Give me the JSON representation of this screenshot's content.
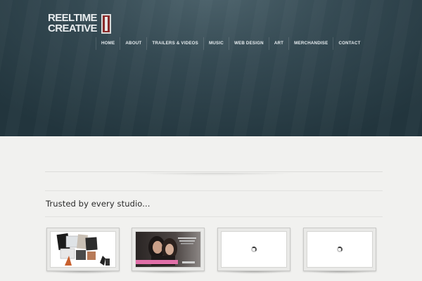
{
  "logo": {
    "line1": "REELTIME",
    "line2": "CREATIVE"
  },
  "nav": {
    "items": [
      "HOME",
      "ABOUT",
      "TRAILERS & VIDEOS",
      "MUSIC",
      "WEB DESIGN",
      "ART",
      "MERCHANDISE",
      "CONTACT"
    ]
  },
  "main": {
    "section_title": "Trusted by every studio..."
  },
  "colors": {
    "header_bg": "#2e444c",
    "page_bg": "#f1f1ef",
    "logo_accent": "#8a2a2a"
  },
  "thumbnails": [
    {
      "state": "image",
      "icon": "collage-thumbnail-icon"
    },
    {
      "state": "image",
      "icon": "portrait-thumbnail-icon"
    },
    {
      "state": "loading",
      "icon": "loading-spinner-icon"
    },
    {
      "state": "loading",
      "icon": "loading-spinner-icon"
    }
  ]
}
